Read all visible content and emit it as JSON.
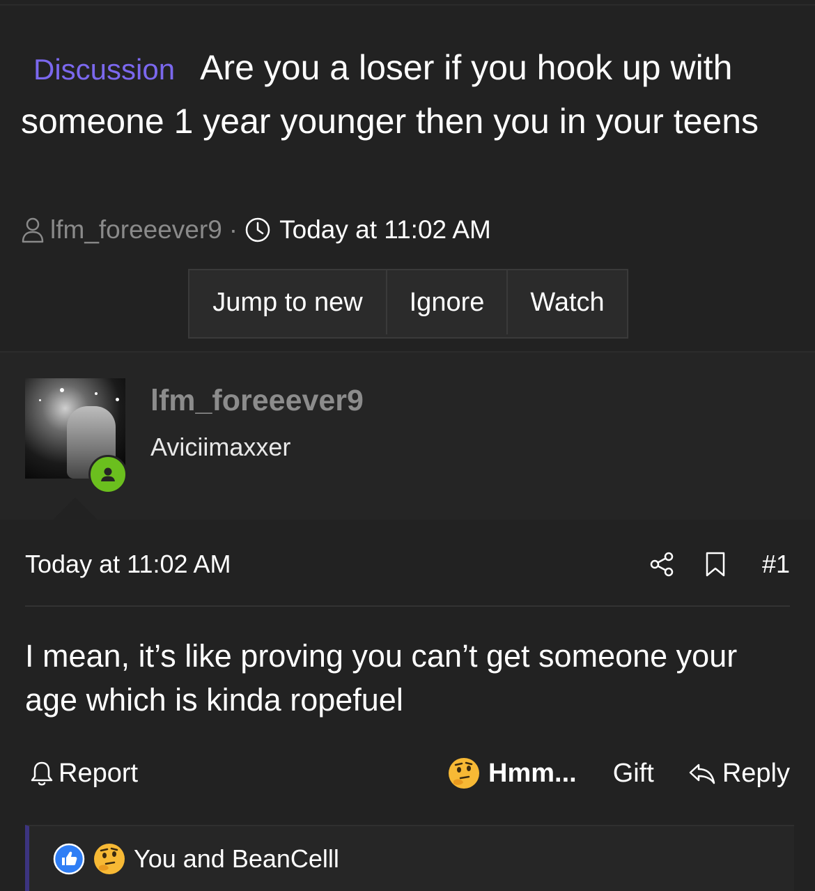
{
  "thread": {
    "prefix": "Discussion",
    "title": "Are you a loser if you hook up with someone 1 year younger then you in your teens",
    "author": "lfm_foreeever9",
    "separator": "·",
    "date": "Today at 11:02 AM"
  },
  "thread_buttons": {
    "jump": "Jump to new",
    "ignore": "Ignore",
    "watch": "Watch"
  },
  "post": {
    "username": "lfm_foreeever9",
    "user_title": "Aviciimaxxer",
    "date": "Today at 11:02 AM",
    "number": "#1",
    "body": "I mean, it’s like proving you can’t get someone your age which is kinda ropefuel",
    "report_label": "Report",
    "reaction_label": "Hmm...",
    "gift_label": "Gift",
    "reply_label": "Reply",
    "reacted_by": "You and BeanCelll"
  },
  "colors": {
    "background": "#222222",
    "prefix": "#7b68ee",
    "online": "#6bbf1e",
    "like": "#2f7ef5",
    "reaction_border": "#3c3480"
  },
  "icons": [
    "user-icon",
    "clock-icon",
    "share-icon",
    "bookmark-icon",
    "bell-icon",
    "reply-icon",
    "like-icon",
    "thinking-face-emoji"
  ]
}
